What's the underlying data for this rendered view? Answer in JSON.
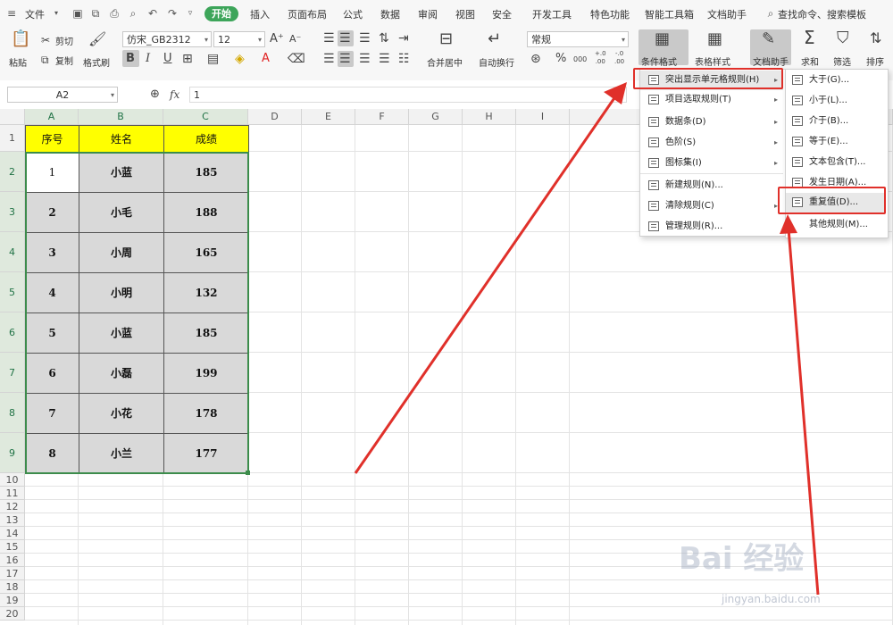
{
  "menubar": {
    "file": "文件",
    "tabs": [
      "开始",
      "插入",
      "页面布局",
      "公式",
      "数据",
      "审阅",
      "视图",
      "安全",
      "开发工具",
      "特色功能",
      "智能工具箱",
      "文档助手"
    ],
    "search": "查找命令、搜索模板"
  },
  "ribbon": {
    "paste": "粘贴",
    "cut": "剪切",
    "copy": "复制",
    "format_painter": "格式刷",
    "font_name": "仿宋_GB2312",
    "font_size": "12",
    "merge_center": "合并居中",
    "wrap_text": "自动换行",
    "number_format": "常规",
    "cond_format": "条件格式",
    "table_style": "表格样式",
    "doc_helper": "文档助手",
    "sum": "求和",
    "filter": "筛选",
    "sort": "排序",
    "bold": "B",
    "italic": "I",
    "underline": "U",
    "font_color_glyph": "A",
    "percent": "%",
    "thousands": "000",
    "inc_decimal": "+.0\n.00",
    "dec_decimal": "-.0\n.00"
  },
  "formula_bar": {
    "name_box": "A2",
    "fx": "fx",
    "value": "1"
  },
  "grid": {
    "columns": [
      "A",
      "B",
      "C",
      "D",
      "E",
      "F",
      "G",
      "H",
      "I",
      "J"
    ],
    "rows": [
      "1",
      "2",
      "3",
      "4",
      "5",
      "6",
      "7",
      "8",
      "9",
      "10",
      "11",
      "12",
      "13",
      "14",
      "15",
      "16",
      "17",
      "18",
      "19",
      "20"
    ],
    "header": [
      "序号",
      "姓名",
      "成绩"
    ],
    "data": [
      [
        "1",
        "小蓝",
        "185"
      ],
      [
        "2",
        "小毛",
        "188"
      ],
      [
        "3",
        "小周",
        "165"
      ],
      [
        "4",
        "小明",
        "132"
      ],
      [
        "5",
        "小蓝",
        "185"
      ],
      [
        "6",
        "小磊",
        "199"
      ],
      [
        "7",
        "小花",
        "178"
      ],
      [
        "8",
        "小兰",
        "177"
      ]
    ]
  },
  "cond_menu": {
    "items": [
      {
        "label": "突出显示单元格规则(H)",
        "submenu": true
      },
      {
        "label": "项目选取规则(T)",
        "submenu": true
      },
      {
        "label": "数据条(D)",
        "submenu": true
      },
      {
        "label": "色阶(S)",
        "submenu": true
      },
      {
        "label": "图标集(I)",
        "submenu": true
      },
      {
        "label": "新建规则(N)...",
        "submenu": false
      },
      {
        "label": "清除规则(C)",
        "submenu": true
      },
      {
        "label": "管理规则(R)...",
        "submenu": false
      }
    ]
  },
  "highlight_submenu": {
    "items": [
      "大于(G)...",
      "小于(L)...",
      "介于(B)...",
      "等于(E)...",
      "文本包含(T)...",
      "发生日期(A)...",
      "重复值(D)...",
      "其他规则(M)..."
    ]
  },
  "watermark": {
    "brand": "Bai 经验",
    "url": "jingyan.baidu.com"
  },
  "colors": {
    "accent_green": "#3da55a",
    "header_yellow": "#ffff00",
    "highlight_red": "#e0302a"
  }
}
